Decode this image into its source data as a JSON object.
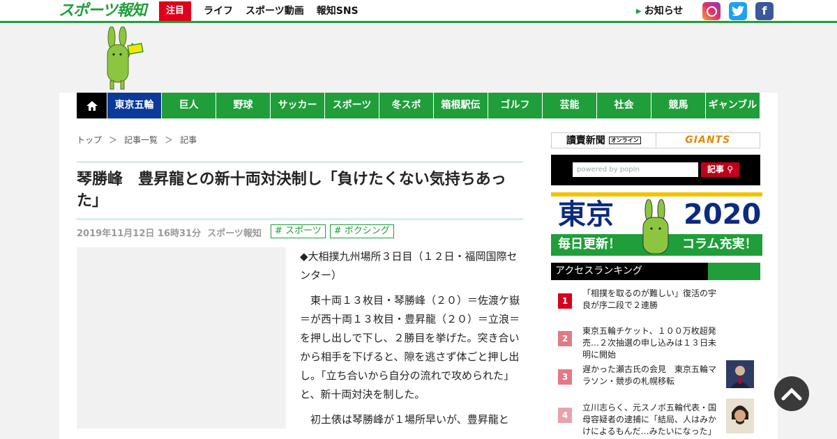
{
  "header": {
    "logo": "スポーツ報知",
    "hot_label": "注目",
    "nav": [
      "ライフ",
      "スポーツ動画",
      "報知SNS"
    ],
    "notice": "お知らせ",
    "social": [
      "instagram-icon",
      "twitter-icon",
      "facebook-icon"
    ]
  },
  "catnav": {
    "items": [
      "東京五輪",
      "巨人",
      "野球",
      "サッカー",
      "スポーツ",
      "冬スポ",
      "箱根駅伝",
      "ゴルフ",
      "芸能",
      "社会",
      "競馬",
      "ギャンブル"
    ],
    "active": 0
  },
  "breadcrumb": [
    "トップ",
    "＞",
    "記事一覧",
    "＞",
    "記事"
  ],
  "article": {
    "title": "琴勝峰　豊昇龍との新十両対決制し「負けたくない気持ちあった」",
    "date": "2019年11月12日 16時31分",
    "source": "スポーツ報知",
    "tags": [
      "# スポーツ",
      "# ボクシング"
    ],
    "paragraphs": [
      "◆大相撲九州場所３日目（１２日・福岡国際センター）",
      "　東十両１３枚目・琴勝峰（２０）＝佐渡ケ嶽＝が西十両１３枚目・豊昇龍（２０）＝立浪＝を押し出しで下し、２勝目を挙げた。突き合いから相手を下げると、隙を逃さず体ごと押し出し。「立ち合いから自分の流れで攻められた」と、新十両対決を制した。",
      "　初土俵は琴勝峰が１場所早いが、豊昇龍と"
    ]
  },
  "sidebar": {
    "yomiuri": "讀賣新聞",
    "yomiuri_tag": "オンライン",
    "giants": "GIANTS",
    "search_placeholder": "powered by popIn",
    "search_button": "記事",
    "banner": {
      "left": "東京",
      "right": "2020",
      "sub_left": "毎日更新！",
      "sub_right": "コラム充実！"
    },
    "ranking_title": "アクセスランキング",
    "ranking": [
      {
        "rank": "1",
        "text": "「相撲を取るのが難しい」復活の宇良が序二段で２連勝",
        "color": "#d6001c"
      },
      {
        "rank": "2",
        "text": "東京五輪チケット、１００万枚超発売…２次抽選の申し込みは１３日未明に開始",
        "color": "#e07a86"
      },
      {
        "rank": "3",
        "text": "遅かった瀬古氏の会見　東京五輪マラソン・競歩の札幌移転",
        "color": "#e07a86"
      },
      {
        "rank": "4",
        "text": "立川志らく、元スノボ五輪代表・国母容疑者の逮捕に「結局、人はみかけによるもんだ…みたいになった」",
        "color": "#e6a3ab"
      }
    ]
  }
}
